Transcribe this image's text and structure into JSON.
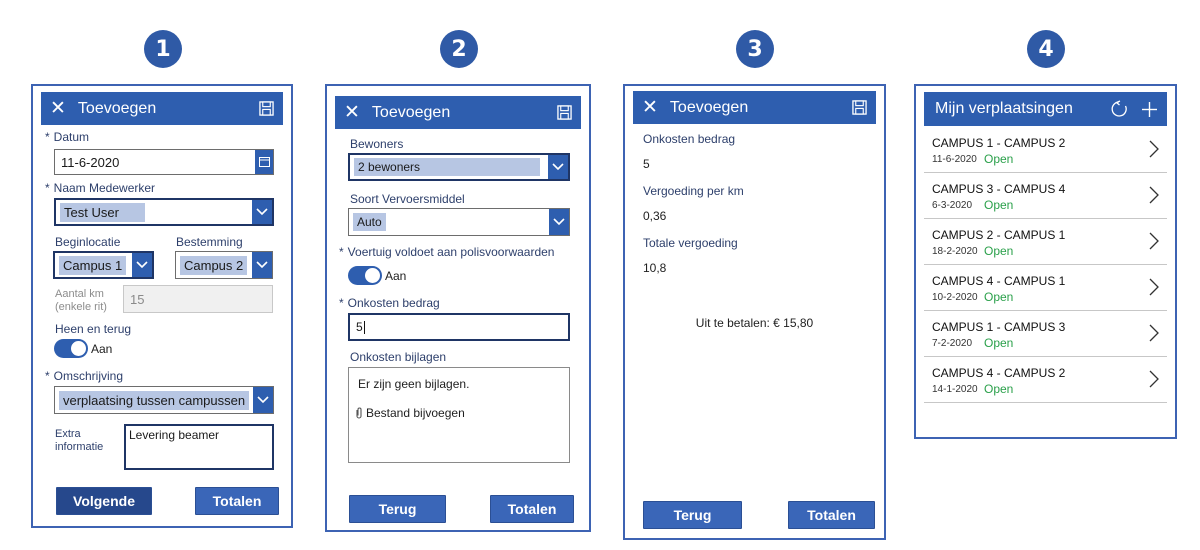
{
  "steps": [
    "1",
    "2",
    "3",
    "4"
  ],
  "colors": {
    "accent": "#2e5eaf",
    "status_open": "#2aa04a",
    "panel_border": "#3d63b3"
  },
  "icons": {
    "close": "close-icon",
    "save": "save-icon",
    "calendar": "calendar-icon",
    "dropdown": "chevron-down-icon",
    "refresh": "refresh-icon",
    "add": "plus-icon",
    "attach": "paperclip-icon",
    "row": "chevron-right-icon"
  },
  "s1": {
    "title": "Toevoegen",
    "datum_label": "Datum",
    "datum_value": "11-6-2020",
    "naam_label": "Naam Medewerker",
    "naam_value": "Test User",
    "begin_label": "Beginlocatie",
    "begin_value": "Campus 1",
    "best_label": "Bestemming",
    "best_value": "Campus 2",
    "km_label": "Aantal km (enkele rit)",
    "km_value": "15",
    "heen_label": "Heen en terug",
    "toggle_label": "Aan",
    "omschr_label": "Omschrijving",
    "omschr_value": "verplaatsing tussen campussen",
    "extra_label": "Extra informatie",
    "extra_value": "Levering beamer",
    "btn_next": "Volgende",
    "btn_totals": "Totalen"
  },
  "s2": {
    "title": "Toevoegen",
    "bew_label": "Bewoners",
    "bew_value": "2 bewoners",
    "soort_label": "Soort Vervoersmiddel",
    "soort_value": "Auto",
    "polis_label": "Voertuig voldoet aan polisvoorwaarden",
    "toggle_label": "Aan",
    "onk_label": "Onkosten bedrag",
    "onk_value": "5",
    "bijl_label": "Onkosten bijlagen",
    "bijl_empty": "Er zijn geen bijlagen.",
    "bijl_add": "Bestand bijvoegen",
    "btn_back": "Terug",
    "btn_totals": "Totalen"
  },
  "s3": {
    "title": "Toevoegen",
    "onk_label": "Onkosten bedrag",
    "onk_value": "5",
    "verg_label": "Vergoeding per km",
    "verg_value": "0,36",
    "tot_label": "Totale vergoeding",
    "tot_value": "10,8",
    "pay_text": "Uit te betalen: € 15,80",
    "btn_back": "Terug",
    "btn_totals": "Totalen"
  },
  "s4": {
    "title": "Mijn verplaatsingen",
    "items": [
      {
        "route": "CAMPUS 1 - CAMPUS 2",
        "date": "11-6-2020",
        "status": "Open"
      },
      {
        "route": "CAMPUS 3 - CAMPUS 4",
        "date": "6-3-2020",
        "status": "Open"
      },
      {
        "route": "CAMPUS 2 - CAMPUS 1",
        "date": "18-2-2020",
        "status": "Open"
      },
      {
        "route": "CAMPUS 4 - CAMPUS 1",
        "date": "10-2-2020",
        "status": "Open"
      },
      {
        "route": "CAMPUS 1 - CAMPUS 3",
        "date": "7-2-2020",
        "status": "Open"
      },
      {
        "route": "CAMPUS 4 - CAMPUS 2",
        "date": "14-1-2020",
        "status": "Open"
      }
    ]
  }
}
